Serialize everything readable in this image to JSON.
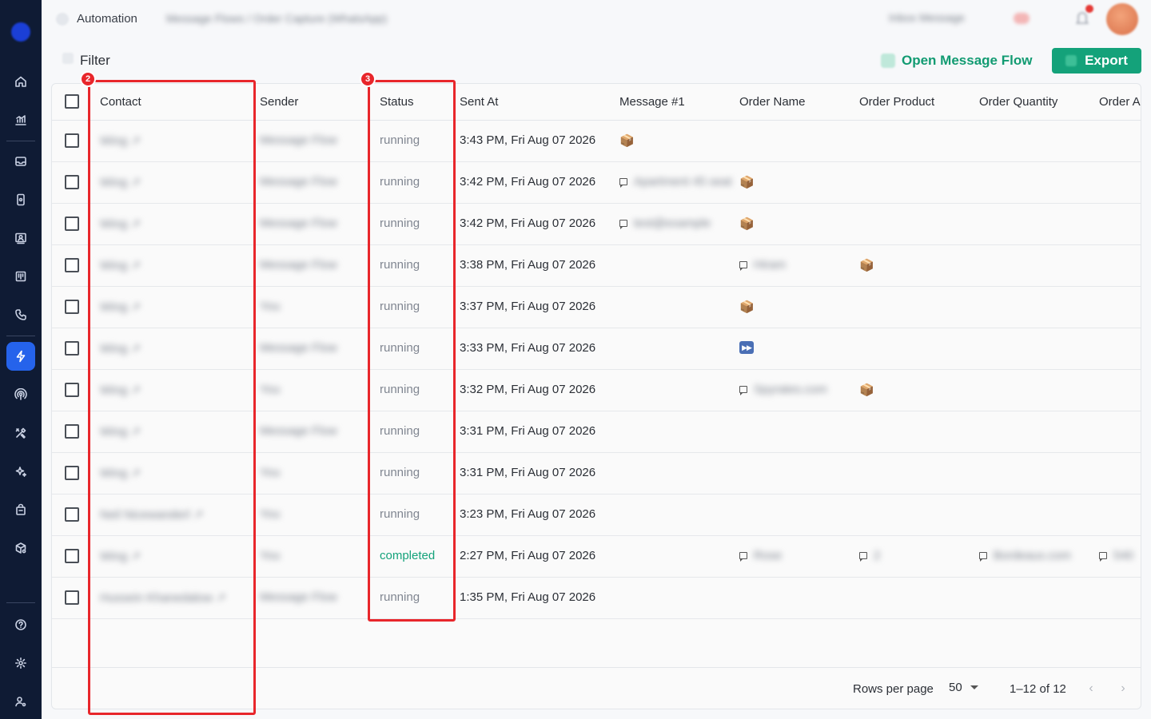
{
  "app": {
    "title": "Automation",
    "breadcrumb_blurred": "Message Flows / Order Capture (WhatsApp)",
    "top_right_blurred": "Inbox Message"
  },
  "sidebar": {
    "icons": [
      "home-icon",
      "analytics-icon",
      "inbox-icon",
      "mobile-icon",
      "contacts-icon",
      "board-icon",
      "phone-icon",
      "automation-icon",
      "broadcast-icon",
      "tools-icon",
      "ai-icon",
      "shop-icon",
      "package-settings-icon",
      "help-icon",
      "settings-icon",
      "user-settings-icon"
    ],
    "active": "automation-icon"
  },
  "toolbar": {
    "filter_label": "Filter",
    "open_flow_label": "Open Message Flow",
    "export_label": "Export"
  },
  "table": {
    "columns": [
      "Contact",
      "Sender",
      "Status",
      "Sent At",
      "Message #1",
      "Order Name",
      "Order Product",
      "Order Quantity",
      "Order A"
    ],
    "rows": [
      {
        "contact": "Wing ↗",
        "sender": "Message Flow",
        "status": "running",
        "sent_at": "3:43 PM, Fri Aug 07 2026",
        "m1": "📦",
        "m1_text": "",
        "on": "",
        "on_text": "",
        "op": "",
        "op_text": "",
        "oq": "",
        "oq_text": "",
        "oa": "",
        "oa_text": ""
      },
      {
        "contact": "Wing ↗",
        "sender": "Message Flow",
        "status": "running",
        "sent_at": "3:42 PM, Fri Aug 07 2026",
        "m1": "chat",
        "m1_text": "Apartment 45 seat",
        "on": "📦",
        "on_text": "",
        "op": "",
        "op_text": "",
        "oq": "",
        "oq_text": "",
        "oa": "",
        "oa_text": ""
      },
      {
        "contact": "Wing ↗",
        "sender": "Message Flow",
        "status": "running",
        "sent_at": "3:42 PM, Fri Aug 07 2026",
        "m1": "chat",
        "m1_text": "test@example",
        "on": "📦",
        "on_text": "",
        "op": "",
        "op_text": "",
        "oq": "",
        "oq_text": "",
        "oa": "",
        "oa_text": ""
      },
      {
        "contact": "Wing ↗",
        "sender": "Message Flow",
        "status": "running",
        "sent_at": "3:38 PM, Fri Aug 07 2026",
        "m1": "",
        "m1_text": "",
        "on": "chat",
        "on_text": "Hiram",
        "op": "📦",
        "op_text": "",
        "oq": "",
        "oq_text": "",
        "oa": "",
        "oa_text": ""
      },
      {
        "contact": "Wing ↗",
        "sender": "You",
        "status": "running",
        "sent_at": "3:37 PM, Fri Aug 07 2026",
        "m1": "",
        "m1_text": "",
        "on": "📦",
        "on_text": "",
        "op": "",
        "op_text": "",
        "oq": "",
        "oq_text": "",
        "oa": "",
        "oa_text": ""
      },
      {
        "contact": "Wing ↗",
        "sender": "Message Flow",
        "status": "running",
        "sent_at": "3:33 PM, Fri Aug 07 2026",
        "m1": "",
        "m1_text": "",
        "on": "ff",
        "on_text": "",
        "op": "",
        "op_text": "",
        "oq": "",
        "oq_text": "",
        "oa": "",
        "oa_text": ""
      },
      {
        "contact": "Wing ↗",
        "sender": "You",
        "status": "running",
        "sent_at": "3:32 PM, Fri Aug 07 2026",
        "m1": "",
        "m1_text": "",
        "on": "chat",
        "on_text": "Spyrates.com",
        "op": "📦",
        "op_text": "",
        "oq": "",
        "oq_text": "",
        "oa": "",
        "oa_text": ""
      },
      {
        "contact": "Wing ↗",
        "sender": "Message Flow",
        "status": "running",
        "sent_at": "3:31 PM, Fri Aug 07 2026",
        "m1": "",
        "m1_text": "",
        "on": "",
        "on_text": "",
        "op": "",
        "op_text": "",
        "oq": "",
        "oq_text": "",
        "oa": "",
        "oa_text": ""
      },
      {
        "contact": "Wing ↗",
        "sender": "You",
        "status": "running",
        "sent_at": "3:31 PM, Fri Aug 07 2026",
        "m1": "",
        "m1_text": "",
        "on": "",
        "on_text": "",
        "op": "",
        "op_text": "",
        "oq": "",
        "oq_text": "",
        "oa": "",
        "oa_text": ""
      },
      {
        "contact": "Neil Nicewanderl ↗",
        "sender": "You",
        "status": "running",
        "sent_at": "3:23 PM, Fri Aug 07 2026",
        "m1": "",
        "m1_text": "",
        "on": "",
        "on_text": "",
        "op": "",
        "op_text": "",
        "oq": "",
        "oq_text": "",
        "oa": "",
        "oa_text": ""
      },
      {
        "contact": "Wing ↗",
        "sender": "You",
        "status": "completed",
        "sent_at": "2:27 PM, Fri Aug 07 2026",
        "m1": "",
        "m1_text": "",
        "on": "chat",
        "on_text": "Rose",
        "op": "chat",
        "op_text": "2",
        "oq": "chat",
        "oq_text": "Bordeaux.com",
        "oa": "chat",
        "oa_text": "540"
      },
      {
        "contact": "Hussein Khanedalow ↗",
        "sender": "Message Flow",
        "status": "running",
        "sent_at": "1:35 PM, Fri Aug 07 2026",
        "m1": "",
        "m1_text": "",
        "on": "",
        "on_text": "",
        "op": "",
        "op_text": "",
        "oq": "",
        "oq_text": "",
        "oa": "",
        "oa_text": ""
      }
    ]
  },
  "footer": {
    "rows_per_page_label": "Rows per page",
    "rows_per_page_value": "50",
    "page_info": "1–12 of 12"
  },
  "annotations": [
    {
      "label": "2",
      "target": "Contact column"
    },
    {
      "label": "3",
      "target": "Status column"
    }
  ],
  "colors": {
    "sidebar_bg": "#0f1b34",
    "active_nav": "#2563eb",
    "accent": "#14a27a",
    "annotation": "#e8262b"
  }
}
